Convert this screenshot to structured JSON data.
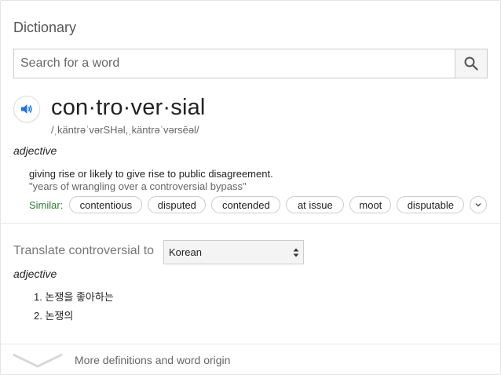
{
  "dictionary": {
    "title": "Dictionary",
    "search_placeholder": "Search for a word"
  },
  "entry": {
    "word": "con·tro·ver·sial",
    "pronunciation": "/ˌkäntrəˈvərSHəl,ˌkäntrəˈvərsēəl/",
    "part_of_speech": "adjective",
    "definition": "giving rise or likely to give rise to public disagreement.",
    "example": "\"years of wrangling over a controversial bypass\"",
    "similar_label": "Similar:",
    "similar": [
      "contentious",
      "disputed",
      "contended",
      "at issue",
      "moot",
      "disputable"
    ]
  },
  "translate": {
    "label": "Translate controversial to",
    "language": "Korean",
    "part_of_speech": "adjective",
    "items": [
      "1. 논쟁을 좋아하는",
      "2. 논쟁의"
    ]
  },
  "footer": {
    "more_label": "More definitions and word origin"
  },
  "icons": {
    "search": "search-icon",
    "speaker": "speaker-icon",
    "expand": "chevron-down-icon",
    "select": "select-arrows-icon",
    "more": "chevron-down-large-icon"
  },
  "colors": {
    "accent_blue": "#1a73e8",
    "similar_green": "#2e7d32",
    "border": "#cccccc"
  }
}
